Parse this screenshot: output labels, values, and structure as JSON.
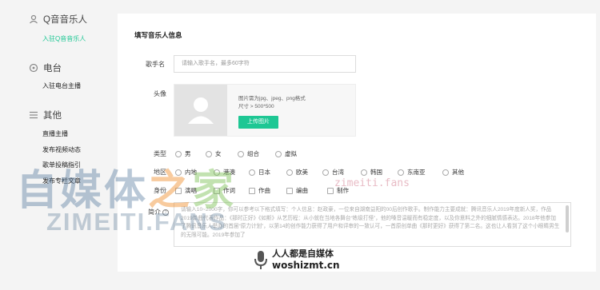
{
  "sidebar": {
    "sections": [
      {
        "title": "Q音音乐人",
        "icon": "user-icon",
        "items": [
          {
            "label": "入驻Q音音乐人",
            "active": true
          }
        ]
      },
      {
        "title": "电台",
        "icon": "radio-icon",
        "items": [
          {
            "label": "入驻电台主播",
            "active": false
          }
        ]
      },
      {
        "title": "其他",
        "icon": "menu-icon",
        "items": [
          {
            "label": "直播主播",
            "active": false
          },
          {
            "label": "发布视频动态",
            "active": false
          },
          {
            "label": "歌单投稿指引",
            "active": false
          },
          {
            "label": "发布专栏文章",
            "active": false
          }
        ]
      }
    ]
  },
  "form": {
    "title": "填写音乐人信息",
    "singer_name": {
      "label": "歌手名",
      "placeholder": "请输入歌手名，最多60字符"
    },
    "avatar": {
      "label": "头像",
      "hint_line1": "图片需为jpg、jpeg、png格式",
      "hint_line2": "尺寸 > 500*500",
      "upload_label": "上传图片"
    },
    "type": {
      "label": "类型",
      "options": [
        "男",
        "女",
        "组合",
        "虚拟"
      ]
    },
    "region": {
      "label": "地区",
      "options": [
        "内地",
        "港澳",
        "日本",
        "欧美",
        "台湾",
        "韩国",
        "东南亚",
        "其他"
      ]
    },
    "identity": {
      "label": "身份",
      "options": [
        "演唱",
        "作词",
        "作曲",
        "编曲",
        "制作"
      ]
    },
    "bio": {
      "label": "简介",
      "placeholder": "请输入10~2000字，你可以参考以下格式填写：个人信息：赵政豪，一位来自湖南益阳的00后创作歌手。制作能力主要成就：腾讯音乐人2019年度新人奖，作品2019单曲代表作品：《那时正好》《如斯》从艺历程：从小就在当地各舞台“练级打怪”，他的嗓音温暖而有稳定度，以及你意料之外的细腻情感表达。2018年他参加了腾讯音乐人举办的首届“原力计划”，以第14的创作能力获得了用户和评审的一致认可，一首原创单曲《那时更好》获得了第二名。这也让人看到了这个小眼睛男生的无限可能。2019年参加了"
    }
  },
  "watermark": {
    "brand_cn_1": "自媒体",
    "brand_cn_2": "之",
    "brand_cn_3": "家",
    "brand_en": "ZIMEITI.FANS",
    "url": "zimeiti.fans",
    "logo_line1": "人人都是自媒体",
    "logo_line2": "woshizmt.cn"
  },
  "colors": {
    "accent": "#1ec794",
    "background": "#f4f4f4",
    "panel": "#ffffff"
  }
}
